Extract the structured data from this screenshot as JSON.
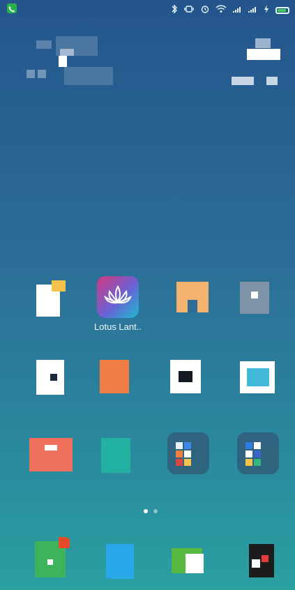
{
  "status_bar": {
    "left_icon": "phone-call-icon",
    "right_icons": [
      "bluetooth-icon",
      "vibrate-icon",
      "alarm-icon",
      "wifi-icon",
      "signal-icon",
      "signal-icon",
      "charging-icon",
      "battery-icon"
    ],
    "battery_level": 0.85
  },
  "home": {
    "apps": [
      {
        "label": ""
      },
      {
        "label": "Lotus Lant.."
      },
      {
        "label": ""
      },
      {
        "label": ""
      },
      {
        "label": ""
      },
      {
        "label": ""
      },
      {
        "label": ""
      },
      {
        "label": ""
      },
      {
        "label": ""
      },
      {
        "label": ""
      },
      {
        "label": ""
      },
      {
        "label": ""
      }
    ],
    "page_indicator": {
      "pages": 2,
      "current": 1
    },
    "dock": [
      {
        "label": ""
      },
      {
        "label": ""
      },
      {
        "label": ""
      },
      {
        "label": ""
      }
    ],
    "lotus_icon_name": "lotus-icon"
  }
}
